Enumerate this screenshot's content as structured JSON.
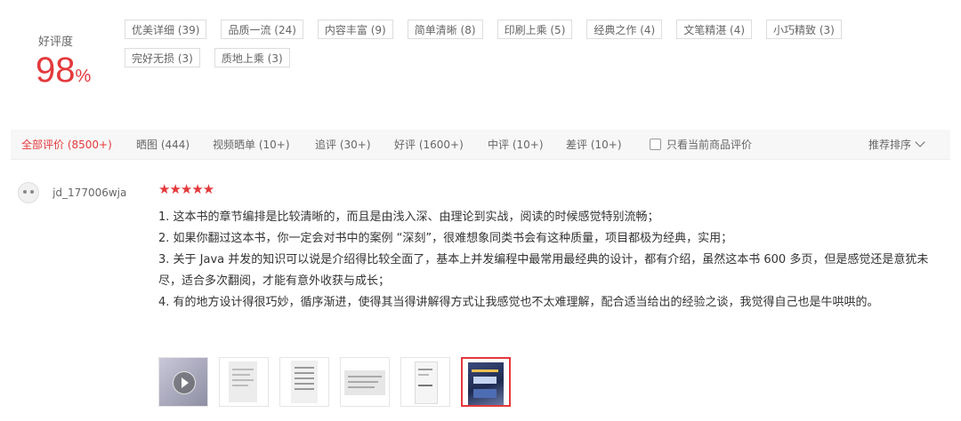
{
  "rating": {
    "label": "好评度",
    "percent": "98",
    "unit": "%"
  },
  "tags": [
    {
      "text": "优美详细 (39)"
    },
    {
      "text": "品质一流 (24)"
    },
    {
      "text": "内容丰富 (9)"
    },
    {
      "text": "简单清晰 (8)"
    },
    {
      "text": "印刷上乘 (5)"
    },
    {
      "text": "经典之作 (4)"
    },
    {
      "text": "文笔精湛 (4)"
    },
    {
      "text": "小巧精致 (3)"
    },
    {
      "text": "完好无损 (3)"
    },
    {
      "text": "质地上乘 (3)"
    }
  ],
  "filters": {
    "items": [
      {
        "label": "全部评价 (8500+)",
        "active": true
      },
      {
        "label": "晒图 (444)",
        "active": false
      },
      {
        "label": "视频晒单 (10+)",
        "active": false
      },
      {
        "label": "追评 (30+)",
        "active": false
      },
      {
        "label": "好评 (1600+)",
        "active": false
      },
      {
        "label": "中评 (10+)",
        "active": false
      },
      {
        "label": "差评 (10+)",
        "active": false
      }
    ],
    "only_current_label": "只看当前商品评价",
    "sort_label": "推荐排序"
  },
  "review": {
    "username": "jd_177006wja",
    "stars": "★★★★★",
    "star_count": 5,
    "lines": [
      "1. 这本书的章节编排是比较清晰的，而且是由浅入深、由理论到实战，阅读的时候感觉特别流畅；",
      "2. 如果你翻过这本书，你一定会对书中的案例 “深刻”，很难想象同类书会有这种质量，项目都极为经典，实用；",
      "3. 关于 Java 并发的知识可以说是介绍得比较全面了，基本上并发编程中最常用最经典的设计，都有介绍，虽然这本书 600 多页，但是感觉还是意犹未尽，适合多次翻阅，才能有意外收获与成长；",
      "4. 有的地方设计得很巧妙，循序渐进，使得其当得讲解得方式让我感觉也不太难理解，配合适当给出的经验之谈，我觉得自己也是牛哄哄的。"
    ]
  },
  "colors": {
    "accent": "#e4393c",
    "text": "#333333",
    "muted": "#666666",
    "border": "#dddddd"
  }
}
